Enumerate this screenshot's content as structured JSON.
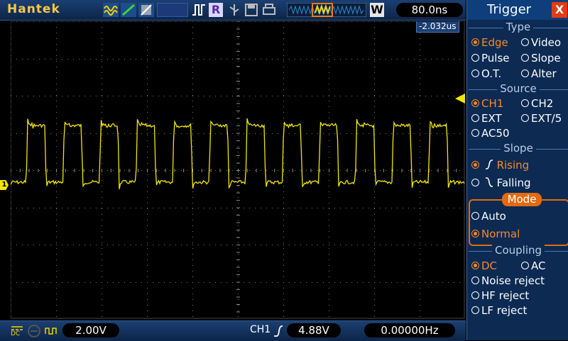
{
  "brand": "Hantek",
  "top": {
    "timebase": "80.0ns",
    "run_label": "R",
    "w_label": "W",
    "trigger_position": "-2.032us"
  },
  "bottom": {
    "coupling_label": "DC",
    "ch1_volts": "2.00V",
    "trigger_channel": "CH1",
    "trigger_level": "4.88V",
    "frequency": "0.00000Hz"
  },
  "channel_marker": "1",
  "trigger_panel": {
    "title": "Trigger",
    "close_label": "X",
    "type": {
      "title": "Type",
      "options": [
        "Edge",
        "Video",
        "Pulse",
        "Slope",
        "O.T.",
        "Alter"
      ],
      "selected": "Edge"
    },
    "source": {
      "title": "Source",
      "options": [
        "CH1",
        "CH2",
        "EXT",
        "EXT/5",
        "AC50"
      ],
      "selected": "CH1"
    },
    "slope": {
      "title": "Slope",
      "options": [
        "Rising",
        "Falling"
      ],
      "selected": "Rising"
    },
    "mode": {
      "title": "Mode",
      "options": [
        "Auto",
        "Normal"
      ],
      "selected": "Normal"
    },
    "coupling": {
      "title": "Coupling",
      "options": [
        "DC",
        "AC",
        "Noise reject",
        "HF reject",
        "LF reject"
      ],
      "selected": "DC"
    }
  },
  "colors": {
    "trace": "#f2e600",
    "accent": "#e36a10",
    "selected": "#f38b2b",
    "panel_bg": "#0c2a52"
  }
}
